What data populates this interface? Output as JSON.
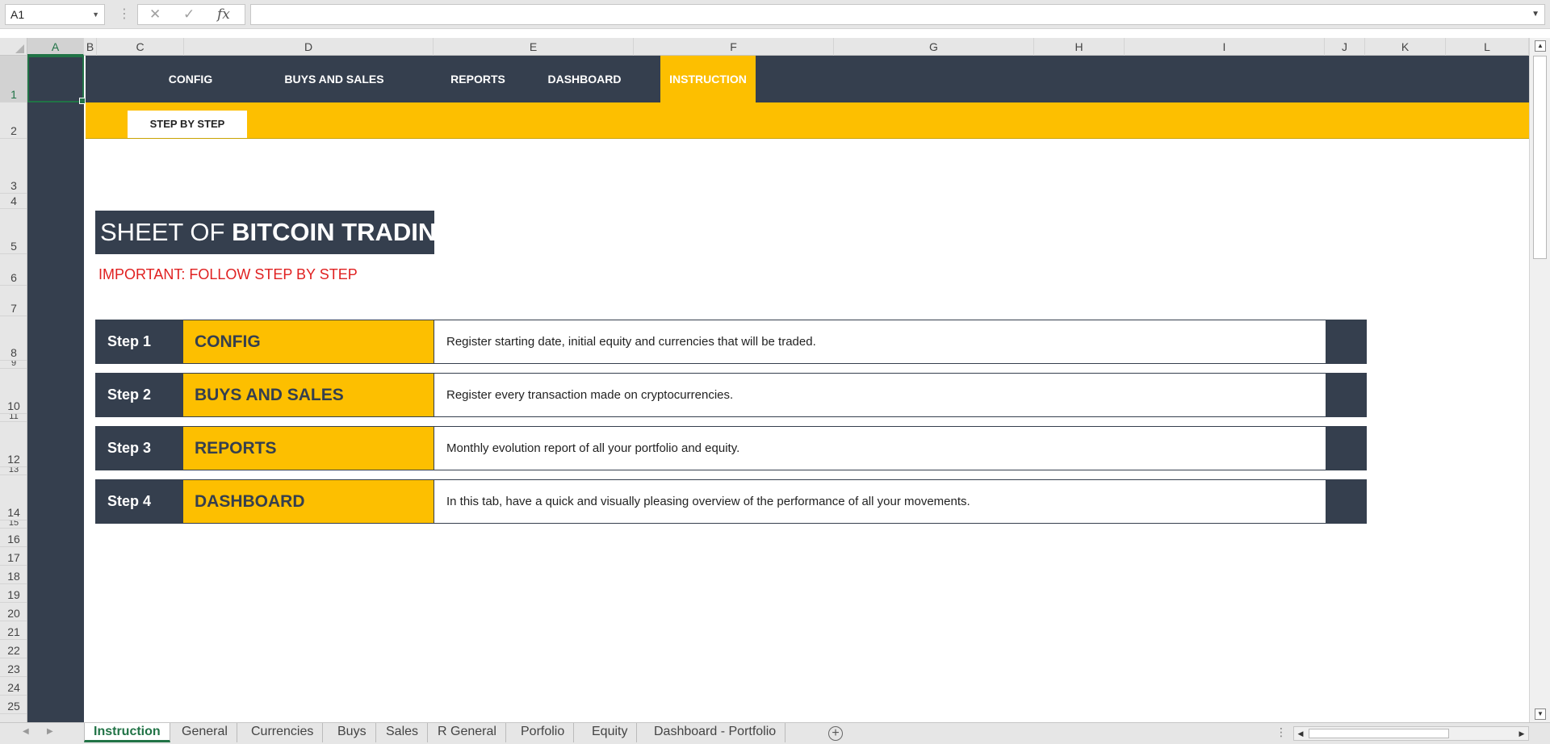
{
  "formula_bar": {
    "name_box": "A1",
    "formula": ""
  },
  "columns": [
    "A",
    "B",
    "C",
    "D",
    "E",
    "F",
    "G",
    "H",
    "I",
    "J",
    "K",
    "L"
  ],
  "rows": [
    "1",
    "2",
    "3",
    "4",
    "5",
    "6",
    "7",
    "8",
    "9",
    "10",
    "11",
    "12",
    "13",
    "14",
    "15",
    "16",
    "17",
    "18",
    "19",
    "20",
    "21",
    "22",
    "23",
    "24",
    "25"
  ],
  "nav": {
    "items": [
      {
        "label": "CONFIG"
      },
      {
        "label": "BUYS AND SALES"
      },
      {
        "label": "REPORTS"
      },
      {
        "label": "DASHBOARD"
      },
      {
        "label": "INSTRUCTION",
        "active": true
      }
    ],
    "sub_tab": "STEP BY STEP"
  },
  "content": {
    "title_light": "SHEET OF ",
    "title_bold": "BITCOIN TRADING",
    "important": "IMPORTANT: FOLLOW STEP BY STEP",
    "steps": [
      {
        "num": "Step 1",
        "name": "CONFIG",
        "desc": "Register starting date, initial equity and currencies that will be traded."
      },
      {
        "num": "Step 2",
        "name": "BUYS AND SALES",
        "desc": "Register every transaction made on cryptocurrencies."
      },
      {
        "num": "Step 3",
        "name": "REPORTS",
        "desc": "Monthly evolution report of all your portfolio and equity."
      },
      {
        "num": "Step 4",
        "name": "DASHBOARD",
        "desc": "In this tab, have a quick and visually pleasing overview of the performance of all your movements."
      }
    ]
  },
  "sheet_tabs": [
    "Instruction",
    "General",
    "Currencies",
    "Buys",
    "Sales",
    "R General",
    "Porfolio",
    "Equity",
    "Dashboard - Portfolio"
  ],
  "active_sheet": "Instruction",
  "colors": {
    "navy": "#353f4e",
    "yellow": "#fdbf00",
    "excel_green": "#217346",
    "warning_red": "#e02020"
  },
  "icons": {
    "cancel": "close-icon",
    "confirm": "check-icon",
    "function": "fx-icon",
    "add_sheet": "plus-circle-icon"
  }
}
